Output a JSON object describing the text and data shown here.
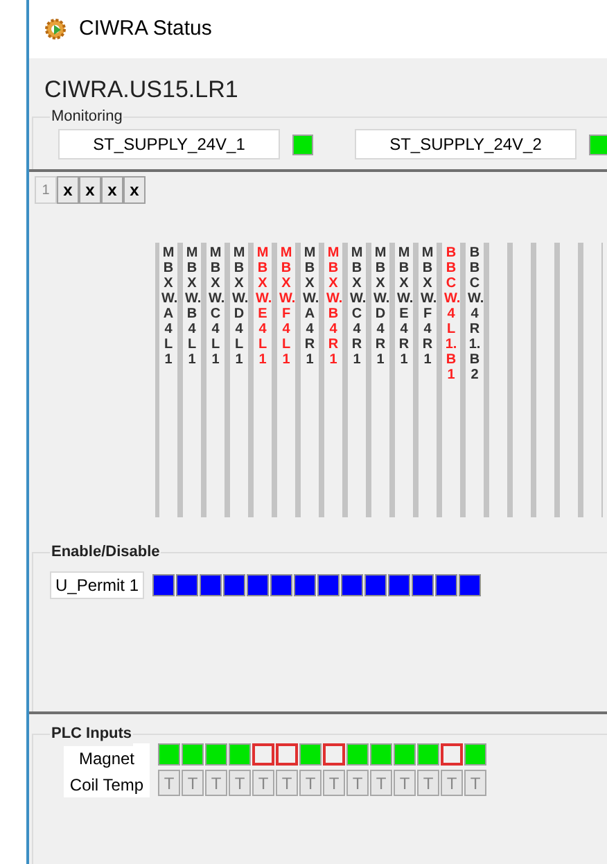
{
  "window": {
    "title": "CIWRA Status"
  },
  "heading": "CIWRA.US15.LR1",
  "monitoring": {
    "title": "Monitoring",
    "signals": [
      {
        "name": "ST_SUPPLY_24V_1",
        "on": true
      },
      {
        "name": "ST_SUPPLY_24V_2",
        "on": true
      }
    ]
  },
  "tabs": [
    {
      "label": "1",
      "selected": true
    },
    {
      "label": "x",
      "selected": false
    },
    {
      "label": "x",
      "selected": false
    },
    {
      "label": "x",
      "selected": false
    },
    {
      "label": "x",
      "selected": false
    }
  ],
  "columns": [
    {
      "label": "MBXW.A4L1",
      "alarm": false
    },
    {
      "label": "MBXW.B4L1",
      "alarm": false
    },
    {
      "label": "MBXW.C4L1",
      "alarm": false
    },
    {
      "label": "MBXW.D4L1",
      "alarm": false
    },
    {
      "label": "MBXW.E4L1",
      "alarm": true
    },
    {
      "label": "MBXW.F4L1",
      "alarm": true
    },
    {
      "label": "MBXW.A4R1",
      "alarm": false
    },
    {
      "label": "MBXW.B4R1",
      "alarm": true
    },
    {
      "label": "MBXW.C4R1",
      "alarm": false
    },
    {
      "label": "MBXW.D4R1",
      "alarm": false
    },
    {
      "label": "MBXW.E4R1",
      "alarm": false
    },
    {
      "label": "MBXW.F4R1",
      "alarm": false
    },
    {
      "label": "BBCW.4L1.B1",
      "alarm": true
    },
    {
      "label": "BBCW.4R1.B2",
      "alarm": false
    }
  ],
  "enable_disable": {
    "title": "Enable/Disable",
    "permit": "U_Permit 1",
    "states": [
      {
        "on": true
      },
      {
        "on": true
      },
      {
        "on": true
      },
      {
        "on": true
      },
      {
        "on": true
      },
      {
        "on": true
      },
      {
        "on": true
      },
      {
        "on": true
      },
      {
        "on": true
      },
      {
        "on": true
      },
      {
        "on": true
      },
      {
        "on": true
      },
      {
        "on": true
      },
      {
        "on": true
      }
    ]
  },
  "plc_inputs": {
    "title": "PLC Inputs",
    "magnet_label": "Magnet",
    "coil_temp_label": "Coil Temp",
    "magnet": [
      {
        "on": true
      },
      {
        "on": true
      },
      {
        "on": true
      },
      {
        "on": true
      },
      {
        "on": false
      },
      {
        "on": false
      },
      {
        "on": true
      },
      {
        "on": false
      },
      {
        "on": true
      },
      {
        "on": true
      },
      {
        "on": true
      },
      {
        "on": true
      },
      {
        "on": false
      },
      {
        "on": true
      }
    ],
    "coil_temp": [
      "T",
      "T",
      "T",
      "T",
      "T",
      "T",
      "T",
      "T",
      "T",
      "T",
      "T",
      "T",
      "T",
      "T"
    ]
  }
}
